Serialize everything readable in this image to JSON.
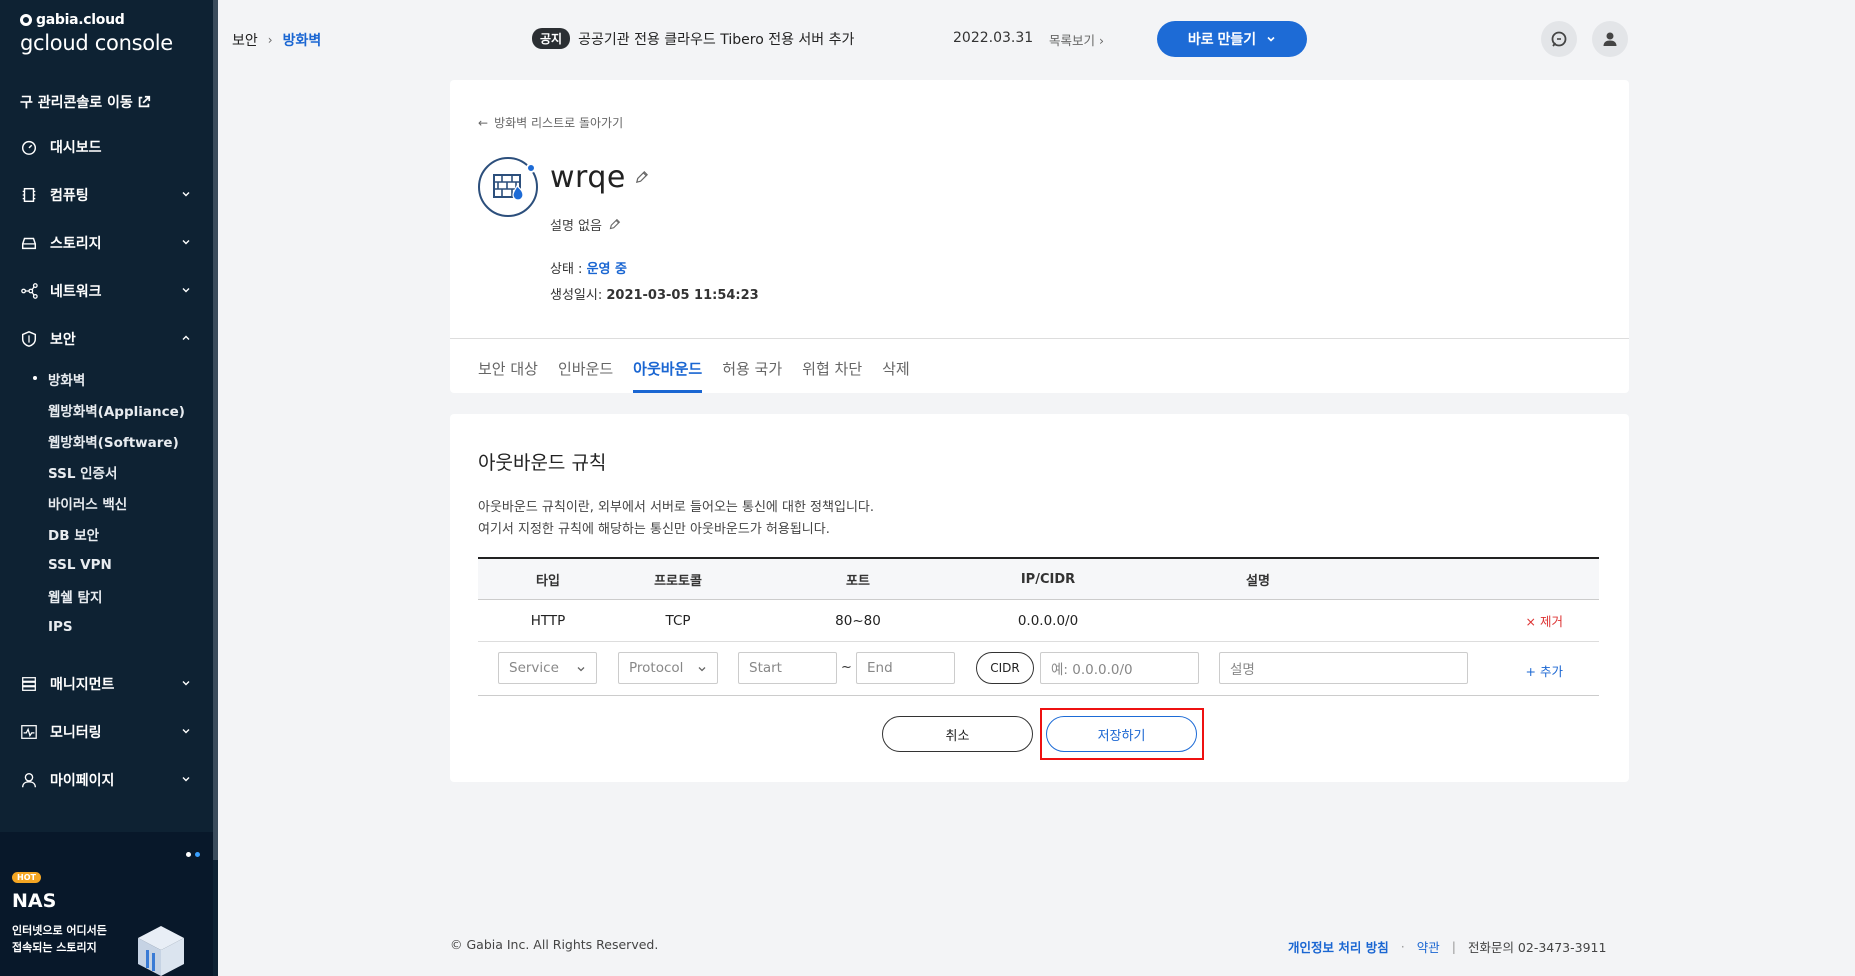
{
  "sidebar": {
    "brand": "gabia.cloud",
    "product": "gcloud console",
    "old_console": "구 관리콘솔로 이동",
    "menu": [
      {
        "label": "대시보드",
        "icon": "dashboard-icon"
      },
      {
        "label": "컴퓨팅",
        "icon": "cpu-icon"
      },
      {
        "label": "스토리지",
        "icon": "storage-icon"
      },
      {
        "label": "네트워크",
        "icon": "network-icon"
      },
      {
        "label": "보안",
        "icon": "shield-icon"
      }
    ],
    "security_sub": [
      "방화벽",
      "웹방화벽(Appliance)",
      "웹방화벽(Software)",
      "SSL 인증서",
      "바이러스 백신",
      "DB 보안",
      "SSL VPN",
      "웹쉘 탐지",
      "IPS"
    ],
    "menu_bottom": [
      {
        "label": "매니지먼트",
        "icon": "management-icon"
      },
      {
        "label": "모니터링",
        "icon": "monitoring-icon"
      },
      {
        "label": "마이페이지",
        "icon": "user-icon"
      }
    ],
    "promo": {
      "badge": "HOT",
      "title": "NAS",
      "desc_line1": "인터넷으로 어디서든",
      "desc_line2": "접속되는 스토리지"
    }
  },
  "topbar": {
    "breadcrumb": [
      "보안",
      "방화벽"
    ],
    "notice_tag": "공지",
    "notice_text": "공공기관 전용 클라우드 Tibero 전용 서버 추가",
    "notice_date": "2022.03.31",
    "notice_list": "목록보기",
    "create_button": "바로 만들기"
  },
  "firewall": {
    "back_link": "방화벽 리스트로 돌아가기",
    "name": "wrqe",
    "description": "설명 없음",
    "status_label": "상태 : ",
    "status_value": "운영 중",
    "created_label": "생성일시: ",
    "created_value": "2021-03-05 11:54:23",
    "tabs": [
      "보안 대상",
      "인바운드",
      "아웃바운드",
      "허용 국가",
      "위협 차단",
      "삭제"
    ],
    "active_tab": "아웃바운드"
  },
  "outbound": {
    "title": "아웃바운드 규칙",
    "desc_line1": "아웃바운드 규칙이란, 외부에서 서버로 들어오는 통신에 대한 정책입니다.",
    "desc_line2": "여기서 지정한 규칙에 해당하는 통신만 아웃바운드가 허용됩니다.",
    "columns": [
      "타입",
      "프로토콜",
      "포트",
      "IP/CIDR",
      "설명"
    ],
    "rows": [
      {
        "type": "HTTP",
        "protocol": "TCP",
        "port": "80~80",
        "ip": "0.0.0.0/0",
        "desc": "",
        "action": "× 제거"
      }
    ],
    "form": {
      "service_placeholder": "Service",
      "protocol_placeholder": "Protocol",
      "start_placeholder": "Start",
      "tilde": "~",
      "end_placeholder": "End",
      "cidr_button": "CIDR",
      "ip_placeholder": "예: 0.0.0.0/0",
      "desc_placeholder": "설명",
      "add_label": "+ 추가"
    },
    "cancel_button": "취소",
    "save_button": "저장하기"
  },
  "footer": {
    "copyright": "© Gabia Inc. All Rights Reserved.",
    "privacy": "개인정보 처리 방침",
    "dot": "·",
    "terms": "약관",
    "sep": "|",
    "phone": "전화문의  02-3473-3911"
  },
  "colors": {
    "sidebar_bg": "#0e2233",
    "accent": "#1d6bd6",
    "highlight": "#e11111",
    "remove": "#dd3333"
  }
}
